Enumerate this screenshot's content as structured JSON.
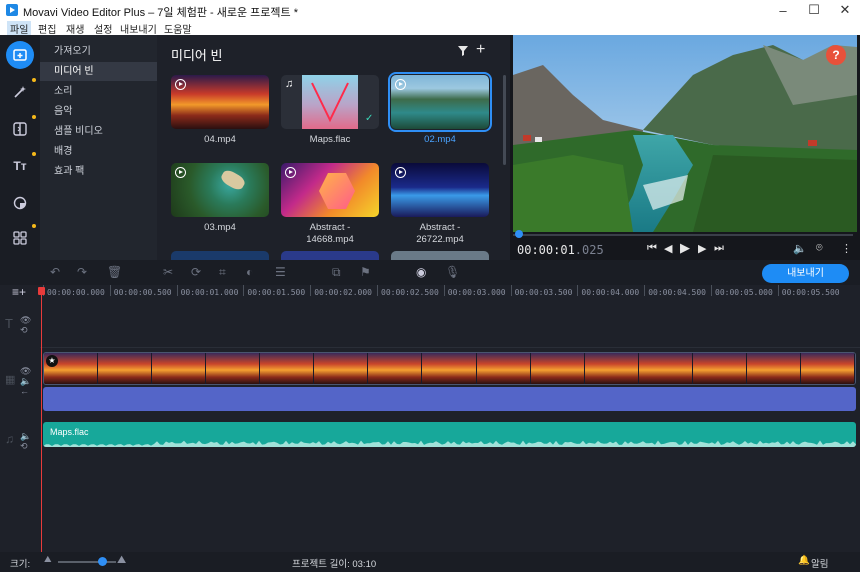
{
  "window": {
    "title": "Movavi Video Editor Plus – 7일 체험판 - 새로운 프로젝트 *"
  },
  "menu": [
    "파일",
    "편집",
    "재생",
    "설정",
    "내보내기",
    "도움말"
  ],
  "nav": [
    "가져오기",
    "미디어 빈",
    "소리",
    "음악",
    "샘플 비디오",
    "배경",
    "효과 팩"
  ],
  "mediabin": {
    "title": "미디어 빈",
    "items": [
      {
        "label": "04.mp4",
        "kind": "video"
      },
      {
        "label": "Maps.flac",
        "kind": "audio"
      },
      {
        "label": "02.mp4",
        "kind": "video",
        "selected": true
      },
      {
        "label": "03.mp4",
        "kind": "video"
      },
      {
        "label": "Abstract -\n14668.mp4",
        "kind": "video"
      },
      {
        "label": "Abstract -\n26722.mp4",
        "kind": "video"
      }
    ]
  },
  "preview": {
    "time_main": "00:00:01",
    "time_ms": ".025",
    "help": "?"
  },
  "toolbar": {
    "export_label": "내보내기"
  },
  "ruler": [
    "00:00:00.000",
    "00:00:00.500",
    "00:00:01.000",
    "00:00:01.500",
    "00:00:02.000",
    "00:00:02.500",
    "00:00:03.000",
    "00:00:03.500",
    "00:00:04.000",
    "00:00:04.500",
    "00:00:05.000",
    "00:00:05.500"
  ],
  "tracks": {
    "music_label": "Maps.flac"
  },
  "status": {
    "size_label": "크기:",
    "project_length": "프로젝트 길이: 03:10",
    "notifications": "알림"
  },
  "colors": {
    "accent": "#1e8cf5",
    "help": "#e8513a",
    "audio_clip": "#5465c8",
    "music_clip": "#17a89a",
    "playhead": "#e83b3b"
  }
}
